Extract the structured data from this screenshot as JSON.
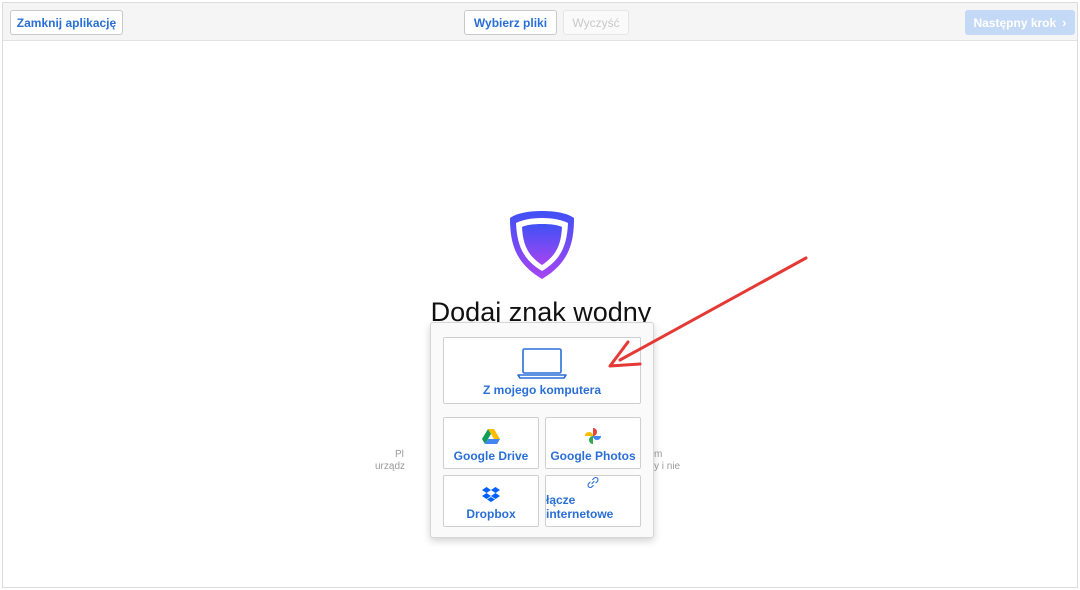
{
  "toolbar": {
    "close_label": "Zamknij aplikację",
    "choose_label": "Wybierz pliki",
    "clear_label": "Wyczyść",
    "next_label": "Następny krok",
    "next_chevron": "›"
  },
  "main": {
    "heading": "Dodaj znak wodny",
    "partial_text_left_1": "Pl",
    "partial_text_left_2": "urządz",
    "partial_text_right_1": "m",
    "partial_text_right_2": "y i nie"
  },
  "upload_menu": {
    "computer_label": "Z mojego komputera",
    "drive_label": "Google Drive",
    "photos_label": "Google Photos",
    "dropbox_label": "Dropbox",
    "link_label": "łącze internetowe"
  },
  "colors": {
    "accent_blue": "#2a6fd6",
    "next_disabled": "#c4d9f5",
    "shield_top": "#3f51f5",
    "shield_bottom": "#a645f2",
    "arrow_red": "#e53935"
  }
}
